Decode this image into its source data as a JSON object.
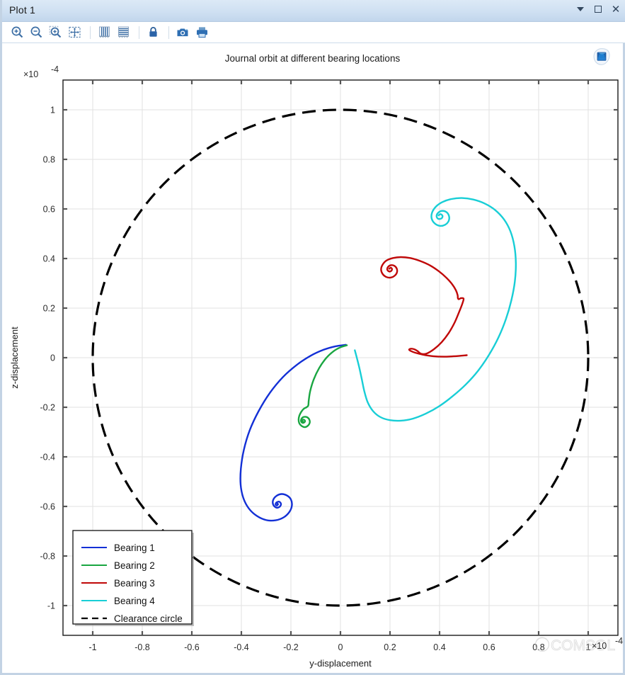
{
  "window": {
    "title": "Plot 1",
    "controls": [
      {
        "name": "dropdown-arrow",
        "label": "▾"
      },
      {
        "name": "maximize",
        "label": "□"
      },
      {
        "name": "close",
        "label": "✕"
      }
    ]
  },
  "toolbar": {
    "buttons": [
      {
        "name": "zoom-in-icon",
        "tooltip": "Zoom In"
      },
      {
        "name": "zoom-out-icon",
        "tooltip": "Zoom Out"
      },
      {
        "name": "zoom-box-icon",
        "tooltip": "Zoom Box"
      },
      {
        "name": "zoom-extents-icon",
        "tooltip": "Zoom Extents"
      },
      {
        "name": "show-grid-vertical-icon",
        "tooltip": "Plot Vertical Grid"
      },
      {
        "name": "show-grid-horizontal-icon",
        "tooltip": "Plot Horizontal Grid"
      },
      {
        "name": "lock-axis-icon",
        "tooltip": "Lock Axis"
      },
      {
        "name": "image-snapshot-icon",
        "tooltip": "Image Snapshot"
      },
      {
        "name": "print-icon",
        "tooltip": "Print"
      }
    ]
  },
  "chart_data": {
    "type": "line",
    "title": "Journal orbit at different bearing locations",
    "xlabel": "y-displacement",
    "ylabel": "z-displacement",
    "x_multiplier": "×10",
    "x_multiplier_exp": "-4",
    "y_multiplier": "×10",
    "y_multiplier_exp": "-4",
    "xlim": [
      -1.12,
      1.12
    ],
    "ylim": [
      -1.12,
      1.12
    ],
    "xticks": [
      -1,
      -0.8,
      -0.6,
      -0.4,
      -0.2,
      0,
      0.2,
      0.4,
      0.6,
      0.8,
      1
    ],
    "xticklabels": [
      "-1",
      "-0.8",
      "-0.6",
      "-0.4",
      "-0.2",
      "0",
      "0.2",
      "0.4",
      "0.6",
      "0.8",
      "1"
    ],
    "yticks": [
      -1,
      -0.8,
      -0.6,
      -0.4,
      -0.2,
      0,
      0.2,
      0.4,
      0.6,
      0.8,
      1
    ],
    "yticklabels": [
      "-1",
      "-0.8",
      "-0.6",
      "-0.4",
      "-0.2",
      "0",
      "0.2",
      "0.4",
      "0.6",
      "0.8",
      "1"
    ],
    "grid": true,
    "legend_position": "lower-left",
    "watermark": "COMSOL",
    "series": [
      {
        "name": "Bearing 1",
        "color": "#1330d6",
        "style": "solid",
        "end_point": [
          -0.268,
          -0.588
        ],
        "points": [
          [
            0.022,
            0.052
          ],
          [
            -0.02,
            0.046
          ],
          [
            -0.068,
            0.032
          ],
          [
            -0.12,
            0.008
          ],
          [
            -0.175,
            -0.028
          ],
          [
            -0.232,
            -0.078
          ],
          [
            -0.285,
            -0.142
          ],
          [
            -0.33,
            -0.215
          ],
          [
            -0.366,
            -0.292
          ],
          [
            -0.39,
            -0.372
          ],
          [
            -0.402,
            -0.448
          ],
          [
            -0.403,
            -0.512
          ],
          [
            -0.392,
            -0.566
          ],
          [
            -0.37,
            -0.608
          ],
          [
            -0.338,
            -0.638
          ],
          [
            -0.3,
            -0.655
          ],
          [
            -0.262,
            -0.656
          ],
          [
            -0.229,
            -0.644
          ],
          [
            -0.206,
            -0.622
          ],
          [
            -0.196,
            -0.596
          ],
          [
            -0.2,
            -0.572
          ],
          [
            -0.216,
            -0.556
          ],
          [
            -0.238,
            -0.55
          ],
          [
            -0.259,
            -0.558
          ],
          [
            -0.272,
            -0.575
          ],
          [
            -0.271,
            -0.594
          ],
          [
            -0.258,
            -0.605
          ],
          [
            -0.245,
            -0.601
          ],
          [
            -0.24,
            -0.59
          ],
          [
            -0.247,
            -0.581
          ],
          [
            -0.258,
            -0.584
          ],
          [
            -0.262,
            -0.592
          ],
          [
            -0.257,
            -0.596
          ],
          [
            -0.252,
            -0.591
          ],
          [
            -0.256,
            -0.587
          ]
        ]
      },
      {
        "name": "Bearing 2",
        "color": "#19a641",
        "style": "solid",
        "end_point": [
          -0.162,
          -0.252
        ],
        "points": [
          [
            0.026,
            0.05
          ],
          [
            0.0,
            0.042
          ],
          [
            -0.028,
            0.026
          ],
          [
            -0.058,
            -0.002
          ],
          [
            -0.086,
            -0.042
          ],
          [
            -0.108,
            -0.088
          ],
          [
            -0.122,
            -0.134
          ],
          [
            -0.128,
            -0.172
          ],
          [
            -0.13,
            -0.193
          ],
          [
            -0.137,
            -0.2
          ],
          [
            -0.148,
            -0.206
          ],
          [
            -0.158,
            -0.218
          ],
          [
            -0.166,
            -0.234
          ],
          [
            -0.169,
            -0.25
          ],
          [
            -0.166,
            -0.265
          ],
          [
            -0.156,
            -0.276
          ],
          [
            -0.143,
            -0.28
          ],
          [
            -0.131,
            -0.274
          ],
          [
            -0.124,
            -0.262
          ],
          [
            -0.126,
            -0.249
          ],
          [
            -0.135,
            -0.24
          ],
          [
            -0.148,
            -0.239
          ],
          [
            -0.157,
            -0.246
          ],
          [
            -0.159,
            -0.256
          ],
          [
            -0.153,
            -0.263
          ],
          [
            -0.146,
            -0.261
          ],
          [
            -0.143,
            -0.255
          ],
          [
            -0.148,
            -0.25
          ],
          [
            -0.154,
            -0.252
          ],
          [
            -0.155,
            -0.257
          ],
          [
            -0.151,
            -0.258
          ]
        ]
      },
      {
        "name": "Bearing 3",
        "color": "#c00808",
        "style": "solid",
        "end_point": [
          0.196,
          0.357
        ],
        "points": [
          [
            0.51,
            0.01
          ],
          [
            0.462,
            0.006
          ],
          [
            0.418,
            0.004
          ],
          [
            0.374,
            0.006
          ],
          [
            0.334,
            0.012
          ],
          [
            0.302,
            0.02
          ],
          [
            0.284,
            0.027
          ],
          [
            0.277,
            0.032
          ],
          [
            0.283,
            0.036
          ],
          [
            0.298,
            0.034
          ],
          [
            0.312,
            0.026
          ],
          [
            0.325,
            0.016
          ],
          [
            0.346,
            0.016
          ],
          [
            0.377,
            0.034
          ],
          [
            0.408,
            0.062
          ],
          [
            0.436,
            0.098
          ],
          [
            0.46,
            0.14
          ],
          [
            0.478,
            0.182
          ],
          [
            0.492,
            0.218
          ],
          [
            0.497,
            0.238
          ],
          [
            0.486,
            0.24
          ],
          [
            0.478,
            0.236
          ],
          [
            0.474,
            0.24
          ],
          [
            0.473,
            0.252
          ],
          [
            0.466,
            0.272
          ],
          [
            0.451,
            0.296
          ],
          [
            0.428,
            0.322
          ],
          [
            0.398,
            0.348
          ],
          [
            0.362,
            0.372
          ],
          [
            0.322,
            0.39
          ],
          [
            0.282,
            0.402
          ],
          [
            0.244,
            0.406
          ],
          [
            0.212,
            0.402
          ],
          [
            0.186,
            0.392
          ],
          [
            0.17,
            0.375
          ],
          [
            0.164,
            0.356
          ],
          [
            0.17,
            0.338
          ],
          [
            0.184,
            0.326
          ],
          [
            0.202,
            0.323
          ],
          [
            0.218,
            0.33
          ],
          [
            0.228,
            0.344
          ],
          [
            0.227,
            0.36
          ],
          [
            0.217,
            0.371
          ],
          [
            0.203,
            0.373
          ],
          [
            0.192,
            0.366
          ],
          [
            0.189,
            0.355
          ],
          [
            0.196,
            0.348
          ],
          [
            0.205,
            0.35
          ],
          [
            0.208,
            0.358
          ],
          [
            0.203,
            0.363
          ],
          [
            0.197,
            0.359
          ]
        ]
      },
      {
        "name": "Bearing 4",
        "color": "#18ced6",
        "style": "solid",
        "end_point": [
          0.38,
          0.577
        ],
        "points": [
          [
            0.058,
            0.03
          ],
          [
            0.066,
            0.0
          ],
          [
            0.076,
            -0.04
          ],
          [
            0.086,
            -0.086
          ],
          [
            0.096,
            -0.134
          ],
          [
            0.11,
            -0.18
          ],
          [
            0.132,
            -0.216
          ],
          [
            0.162,
            -0.24
          ],
          [
            0.2,
            -0.252
          ],
          [
            0.244,
            -0.254
          ],
          [
            0.292,
            -0.246
          ],
          [
            0.344,
            -0.226
          ],
          [
            0.398,
            -0.196
          ],
          [
            0.452,
            -0.156
          ],
          [
            0.506,
            -0.108
          ],
          [
            0.556,
            -0.052
          ],
          [
            0.6,
            0.012
          ],
          [
            0.638,
            0.082
          ],
          [
            0.668,
            0.156
          ],
          [
            0.69,
            0.232
          ],
          [
            0.704,
            0.308
          ],
          [
            0.708,
            0.382
          ],
          [
            0.702,
            0.45
          ],
          [
            0.686,
            0.51
          ],
          [
            0.66,
            0.558
          ],
          [
            0.624,
            0.596
          ],
          [
            0.582,
            0.622
          ],
          [
            0.536,
            0.638
          ],
          [
            0.49,
            0.644
          ],
          [
            0.448,
            0.64
          ],
          [
            0.412,
            0.628
          ],
          [
            0.386,
            0.61
          ],
          [
            0.37,
            0.586
          ],
          [
            0.368,
            0.562
          ],
          [
            0.38,
            0.542
          ],
          [
            0.4,
            0.532
          ],
          [
            0.422,
            0.536
          ],
          [
            0.437,
            0.552
          ],
          [
            0.438,
            0.572
          ],
          [
            0.427,
            0.588
          ],
          [
            0.408,
            0.592
          ],
          [
            0.393,
            0.583
          ],
          [
            0.388,
            0.57
          ],
          [
            0.395,
            0.56
          ],
          [
            0.408,
            0.562
          ],
          [
            0.412,
            0.572
          ],
          [
            0.404,
            0.579
          ],
          [
            0.396,
            0.574
          ]
        ]
      },
      {
        "name": "Clearance circle",
        "color": "#000000",
        "style": "dashed",
        "shape": "circle",
        "radius": 1.0,
        "center": [
          0,
          0
        ]
      }
    ]
  }
}
